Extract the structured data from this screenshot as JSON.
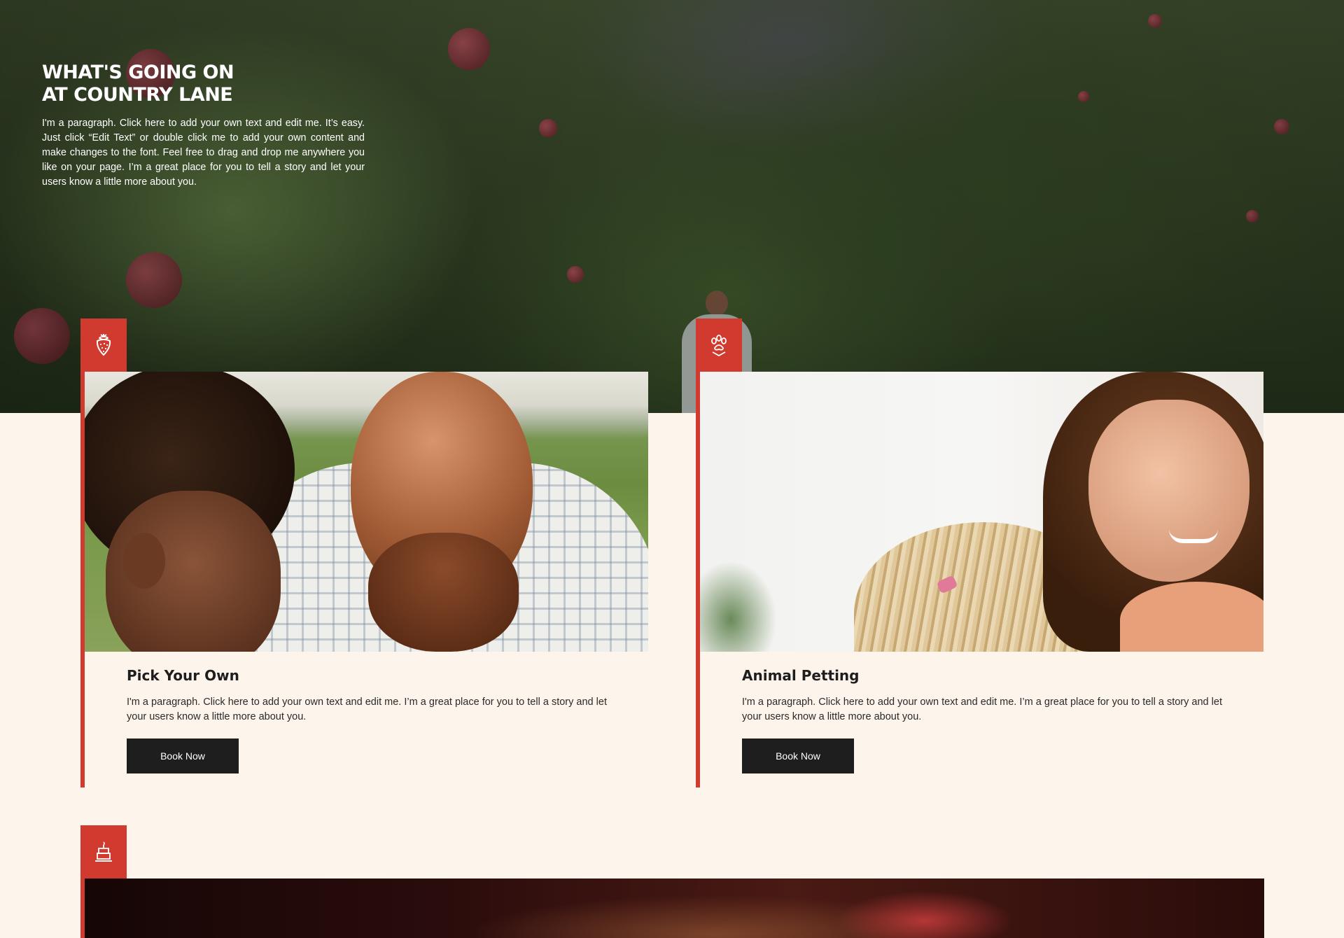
{
  "hero": {
    "title": "WHAT'S GOING ON\nAT COUNTRY LANE",
    "paragraph": "I'm a paragraph. Click here to add your own text and edit me. It’s easy. Just click “Edit Text” or double click me to add your own content and make changes to the font. Feel free to drag and drop me anywhere you like on your page. I’m a great place for you to tell a story and let your users know a little more about you."
  },
  "cards": [
    {
      "icon": "strawberry-icon",
      "title": "Pick Your Own",
      "paragraph": "I'm a paragraph. Click here to add your own text and edit me. I’m a great place for you to tell a story and let your users know a little more about you.",
      "button": "Book Now"
    },
    {
      "icon": "paw-icon",
      "title": "Animal Petting",
      "paragraph": "I'm a paragraph. Click here to add your own text and edit me. I’m a great place for you to tell a story and let your users know a little more about you.",
      "button": "Book Now"
    },
    {
      "icon": "cake-icon"
    }
  ],
  "colors": {
    "accent": "#d13a2e",
    "background": "#fdf4ec",
    "button": "#1e1e1e"
  }
}
